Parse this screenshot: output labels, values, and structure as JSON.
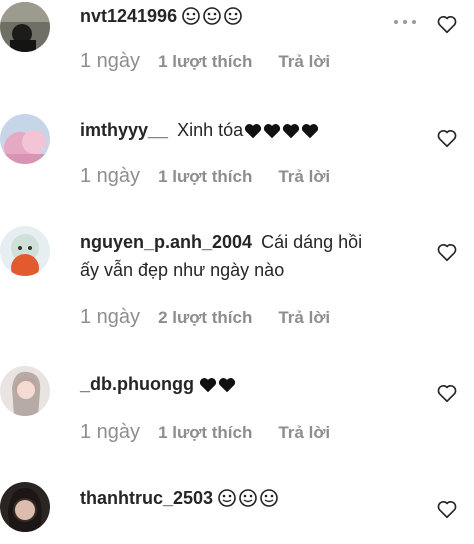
{
  "comments": [
    {
      "username": "nvt1241996",
      "text": "",
      "emojis": "3x slightly-smiling-face",
      "time": "1 ngày",
      "likes": "1 lượt thích",
      "reply": "Trả lời",
      "has_more_menu": true
    },
    {
      "username": "imthyyy__",
      "text": "Xinh tóa",
      "black_hearts": 4,
      "time": "1 ngày",
      "likes": "1 lượt thích",
      "reply": "Trả lời"
    },
    {
      "username": "nguyen_p.anh_2004",
      "text": "Cái dáng hồi",
      "text_line2": "ấy vẫn đẹp như ngày nào",
      "time": "1 ngày",
      "likes": "2 lượt thích",
      "reply": "Trả lời"
    },
    {
      "username": "_db.phuongg",
      "text": "",
      "black_hearts": 2,
      "time": "1 ngày",
      "likes": "1 lượt thích",
      "reply": "Trả lời"
    },
    {
      "username": "thanhtruc_2503",
      "text": "",
      "emojis": "3x slightly-smiling-face"
    }
  ],
  "icons": {
    "like": "heart-outline-icon",
    "more": "more-horizontal-icon"
  },
  "colors": {
    "text": "#262626",
    "meta": "#8e8e8e"
  }
}
